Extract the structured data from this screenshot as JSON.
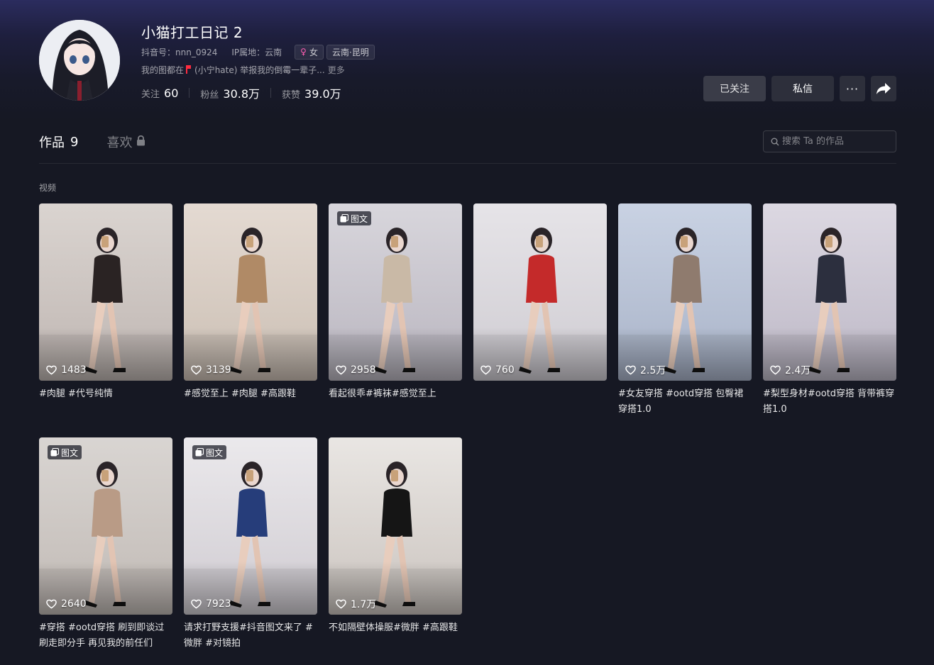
{
  "profile": {
    "name": "小猫打工日记 2",
    "douyin_id": "抖音号：nnn_0924",
    "ip_location": "IP属地：云南",
    "gender_symbol": "♀",
    "gender": "女",
    "region": "云南·昆明",
    "bio_prefix": "我的图都在",
    "bio_rest": "(小宁hate) 举报我的倒霉一辈子...",
    "bio_more": "更多",
    "stats": [
      {
        "label": "关注",
        "value": "60"
      },
      {
        "label": "粉丝",
        "value": "30.8万"
      },
      {
        "label": "获赞",
        "value": "39.0万"
      }
    ]
  },
  "actions": {
    "follow_label": "已关注",
    "message_label": "私信",
    "more_label": "···"
  },
  "tabs": {
    "works_label": "作品",
    "works_count": "9",
    "likes_label": "喜欢"
  },
  "search": {
    "placeholder": "搜索 Ta 的作品"
  },
  "section_label": "视频",
  "posts": [
    {
      "likes": "1483",
      "caption": "#肉腿 #代号纯情",
      "badge": ""
    },
    {
      "likes": "3139",
      "caption": "#感觉至上 #肉腿 #高跟鞋",
      "badge": ""
    },
    {
      "likes": "2958",
      "caption": "看起很乖#裤袜#感觉至上",
      "badge": "图文"
    },
    {
      "likes": "760",
      "caption": "",
      "badge": ""
    },
    {
      "likes": "2.5万",
      "caption": "#女友穿搭 #ootd穿搭 包臀裙穿搭1.0",
      "badge": ""
    },
    {
      "likes": "2.4万",
      "caption": "#梨型身材#ootd穿搭 背带裤穿搭1.0",
      "badge": ""
    },
    {
      "likes": "2640",
      "caption": "#穿搭 #ootd穿搭 刷到即谈过 刷走即分手 再见我的前任们",
      "badge": "图文"
    },
    {
      "likes": "7923",
      "caption": "请求打野支援#抖音图文来了 #微胖 #对镜拍",
      "badge": "图文"
    },
    {
      "likes": "1.7万",
      "caption": "不如隔壁体操服#微胖 #高跟鞋",
      "badge": ""
    }
  ],
  "colors": {
    "background": "#161823",
    "header_gradient_top": "#2b2c5e",
    "gender_pink": "#ff5fb2",
    "flag_red": "#ff2b3f"
  },
  "icons": [
    "heart-icon",
    "image-text-icon",
    "lock-icon",
    "search-icon",
    "share-arrow-icon",
    "more-icon"
  ]
}
